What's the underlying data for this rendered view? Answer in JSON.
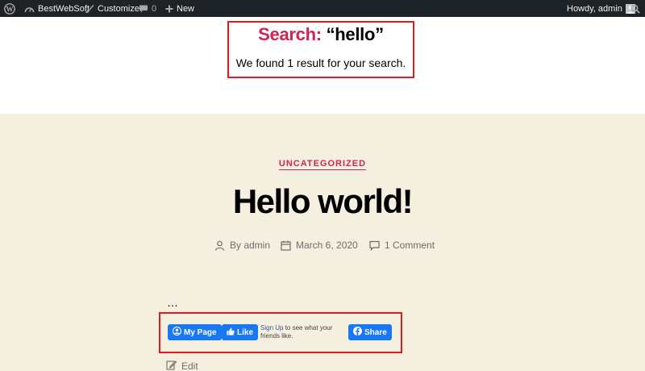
{
  "admin_bar": {
    "site_name": "BestWebSoft",
    "customize_label": "Customize",
    "comments_count": "0",
    "new_label": "New",
    "howdy_label": "Howdy, admin",
    "icons": [
      "wordpress-logo-icon",
      "dashboard-icon",
      "brush-icon",
      "comment-icon",
      "plus-icon",
      "avatar",
      "search-icon"
    ]
  },
  "search_header": {
    "prefix": "Search:",
    "query": "“hello”",
    "result_text": "We found 1 result for your search."
  },
  "post": {
    "category": "UNCATEGORIZED",
    "title": "Hello world!",
    "meta": {
      "author": "By admin",
      "date": "March 6, 2020",
      "comments": "1 Comment"
    },
    "excerpt": "…",
    "edit_label": "Edit"
  },
  "social": {
    "my_page_label": "My Page",
    "like_label": "Like",
    "signup_link": "Sign Up",
    "signup_text": " to see what your friends like.",
    "share_label": "Share"
  },
  "colors": {
    "accent": "#cd2653",
    "admin_bar_bg": "#1d2327",
    "post_bg": "#f5efe0",
    "facebook_blue": "#1877f2",
    "highlight_border": "#e41b1b"
  }
}
